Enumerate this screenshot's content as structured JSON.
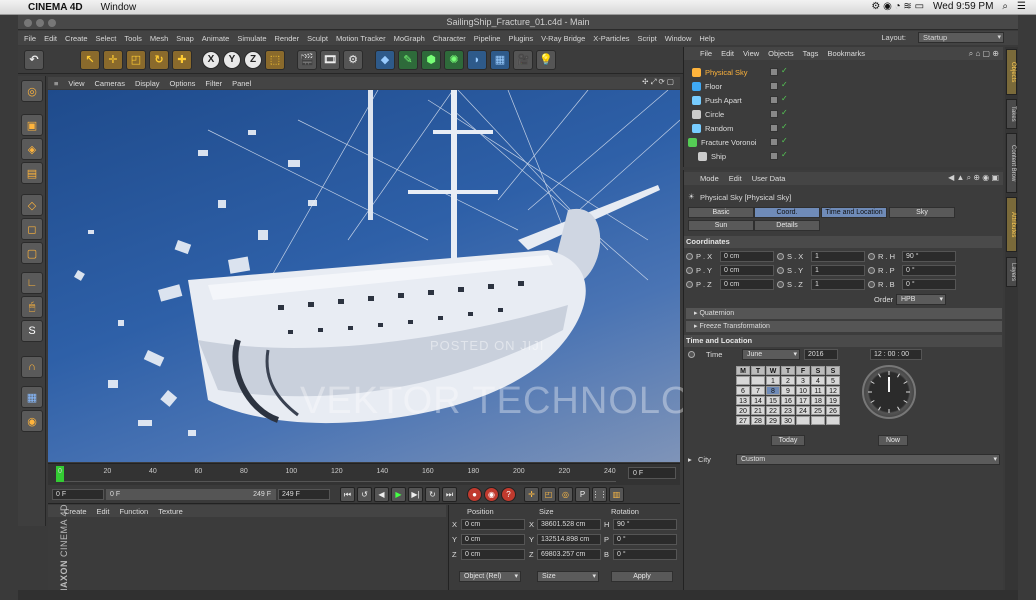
{
  "macbar": {
    "app": "CINEMA 4D",
    "menu": "Window",
    "clock": "Wed 9:59 PM"
  },
  "window": {
    "title": "SailingShip_Fracture_01.c4d - Main"
  },
  "menubar": [
    "File",
    "Edit",
    "Create",
    "Select",
    "Tools",
    "Mesh",
    "Snap",
    "Animate",
    "Simulate",
    "Render",
    "Sculpt",
    "Motion Tracker",
    "MoGraph",
    "Character",
    "Pipeline",
    "Plugins",
    "V-Ray Bridge",
    "X-Particles",
    "Script",
    "Window",
    "Help"
  ],
  "layout": {
    "label": "Layout:",
    "value": "Startup"
  },
  "viewport": {
    "menu": [
      "View",
      "Cameras",
      "Display",
      "Options",
      "Filter",
      "Panel"
    ]
  },
  "timeline": {
    "ticks": [
      "0",
      "20",
      "40",
      "60",
      "80",
      "100",
      "120",
      "140",
      "160",
      "180",
      "200",
      "220",
      "240"
    ],
    "current": "0 F"
  },
  "transport": {
    "start": "0 F",
    "range_start": "0 F",
    "range_end": "249 F",
    "end": "249 F"
  },
  "material": {
    "menu": [
      "Create",
      "Edit",
      "Function",
      "Texture"
    ],
    "brand1": "MAXON",
    "brand2": "CINEMA 4D"
  },
  "coords": {
    "headers": [
      "Position",
      "Size",
      "Rotation"
    ],
    "rows": [
      {
        "axis": "X",
        "pos": "0 cm",
        "saxis": "X",
        "size": "38601.528 cm",
        "raxis": "H",
        "rot": "90 °"
      },
      {
        "axis": "Y",
        "pos": "0 cm",
        "saxis": "Y",
        "size": "132514.898 cm",
        "raxis": "P",
        "rot": "0 °"
      },
      {
        "axis": "Z",
        "pos": "0 cm",
        "saxis": "Z",
        "size": "69803.257 cm",
        "raxis": "B",
        "rot": "0 °"
      }
    ],
    "mode": "Object (Rel)",
    "sizemode": "Size",
    "apply": "Apply"
  },
  "objects": {
    "menu": [
      "File",
      "Edit",
      "View",
      "Objects",
      "Tags",
      "Bookmarks"
    ],
    "items": [
      "Physical Sky",
      "Floor",
      "Push Apart",
      "Circle",
      "Random",
      "Fracture Voronoi",
      "Ship"
    ]
  },
  "attributes": {
    "menu": [
      "Mode",
      "Edit",
      "User Data"
    ],
    "title": "Physical Sky [Physical Sky]",
    "tabs": [
      "Basic",
      "Coord.",
      "Time and Location",
      "Sky",
      "Sun",
      "Details"
    ],
    "coordinates": "Coordinates",
    "coord_rows": [
      {
        "a": "P . X",
        "av": "0 cm",
        "b": "S . X",
        "bv": "1",
        "c": "R . H",
        "cv": "90 °"
      },
      {
        "a": "P . Y",
        "av": "0 cm",
        "b": "S . Y",
        "bv": "1",
        "c": "R . P",
        "cv": "0 °"
      },
      {
        "a": "P . Z",
        "av": "0 cm",
        "b": "S . Z",
        "bv": "1",
        "c": "R . B",
        "cv": "0 °"
      }
    ],
    "order_label": "Order",
    "order": "HPB",
    "quaternion": "Quaternion",
    "freeze": "Freeze Transformation",
    "time_loc": "Time and Location",
    "time_label": "Time",
    "month": "June",
    "year": "2016",
    "time": "12 : 00 : 00",
    "weekdays": [
      "M",
      "T",
      "W",
      "T",
      "F",
      "S",
      "S"
    ],
    "days": [
      "",
      "",
      "1",
      "2",
      "3",
      "4",
      "5",
      "6",
      "7",
      "8",
      "9",
      "10",
      "11",
      "12",
      "13",
      "14",
      "15",
      "16",
      "17",
      "18",
      "19",
      "20",
      "21",
      "22",
      "23",
      "24",
      "25",
      "26",
      "27",
      "28",
      "29",
      "30",
      "",
      "",
      ""
    ],
    "today": "Today",
    "now": "Now",
    "city_label": "City",
    "city": "Custom"
  },
  "right_tabs": [
    "Objects",
    "Takes",
    "Content Brow",
    "Attributes",
    "Layers"
  ],
  "watermark": {
    "line1": "POSTED ON JIJI",
    "line2": "VEKTOR TECHNOLOGY"
  }
}
